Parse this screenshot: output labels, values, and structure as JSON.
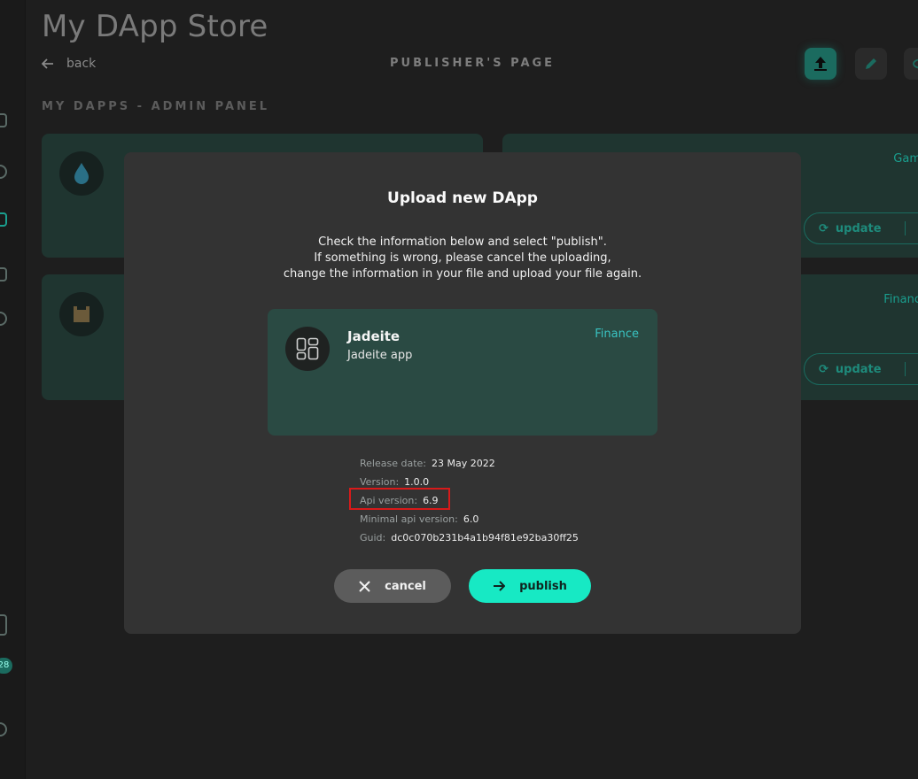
{
  "app": {
    "title": "My DApp Store"
  },
  "header": {
    "back_label": "back",
    "page_title": "PUBLISHER'S PAGE",
    "section_title": "MY DAPPS - ADMIN PANEL"
  },
  "sidebar": {
    "badge": "28"
  },
  "background_cards": [
    {
      "category": "Game",
      "action": "update"
    },
    {
      "category": "Finance",
      "action": "update"
    }
  ],
  "modal": {
    "title": "Upload new DApp",
    "instructions": [
      "Check the information below and select \"publish\".",
      "If something is wrong, please cancel the uploading,",
      "change the information in your file and upload your file again."
    ],
    "dapp": {
      "name": "Jadeite",
      "description": "Jadeite app",
      "category": "Finance"
    },
    "meta": {
      "release_date_label": "Release date:",
      "release_date": "23 May 2022",
      "version_label": "Version:",
      "version": "1.0.0",
      "api_version_label": "Api version:",
      "api_version": "6.9",
      "min_api_label": "Minimal api version:",
      "min_api": "6.0",
      "guid_label": "Guid:",
      "guid": "dc0c070b231b4a1b94f81e92ba30ff25"
    },
    "cancel_label": "cancel",
    "publish_label": "publish"
  },
  "colors": {
    "accent": "#17e9c4",
    "card_bg": "#2a4a43",
    "highlight": "#d81a1a"
  }
}
